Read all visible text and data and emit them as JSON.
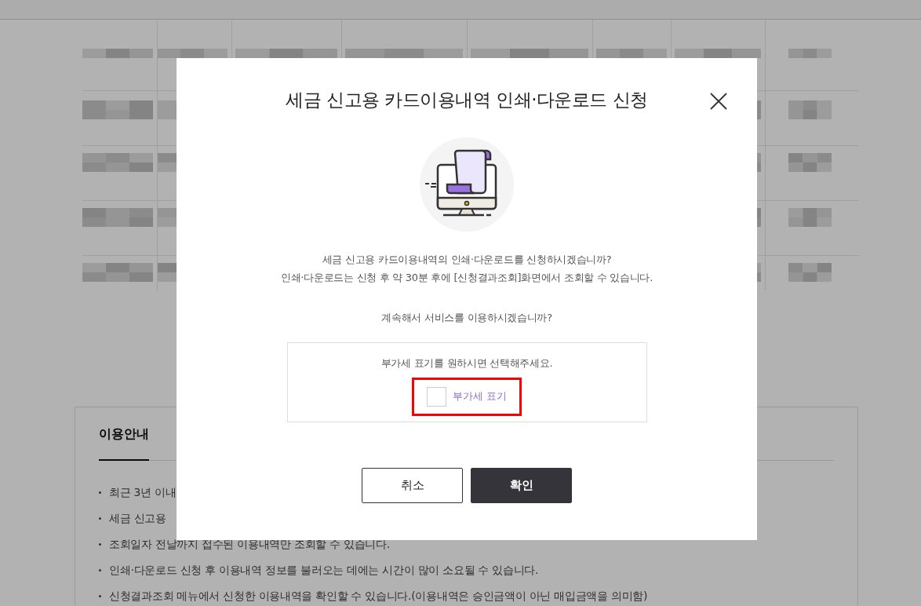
{
  "guide": {
    "title": "이용안내",
    "items": [
      {
        "text": "최근 3년 이내"
      },
      {
        "text": "세금 신고용"
      },
      {
        "text": "조회일자 전날까지 접수된 이용내역만 조회할 수 있습니다."
      },
      {
        "text": "인쇄·다운로드 신청 후 이용내역 정보를 불러오는 데에는 시간이 많이 소요될 수 있습니다."
      },
      {
        "text": "신청결과조회 메뉴에서 신청한 이용내역을 확인할 수 있습니다.(이용내역은 승인금액이 아닌 매입금액을 의미함)"
      }
    ]
  },
  "dialog": {
    "title": "세금 신고용 카드이용내역 인쇄·다운로드 신청",
    "messages": [
      "세금 신고용 카드이용내역의 인쇄·다운로드를 신청하시겠습니까?",
      "인쇄·다운로드는 신청 후 약 30분 후에 [신청결과조회]화면에서 조회할 수 있습니다."
    ],
    "question": "계속해서 서비스를 이용하시겠습니까?",
    "option_box": {
      "hint": "부가세 표기를 원하시면 선택해주세요.",
      "checkbox": {
        "label": "부가세 표기",
        "checked": false,
        "highlighted": true
      }
    },
    "buttons": [
      {
        "label": "취소",
        "kind": "secondary"
      },
      {
        "label": "확인",
        "kind": "primary"
      }
    ]
  }
}
